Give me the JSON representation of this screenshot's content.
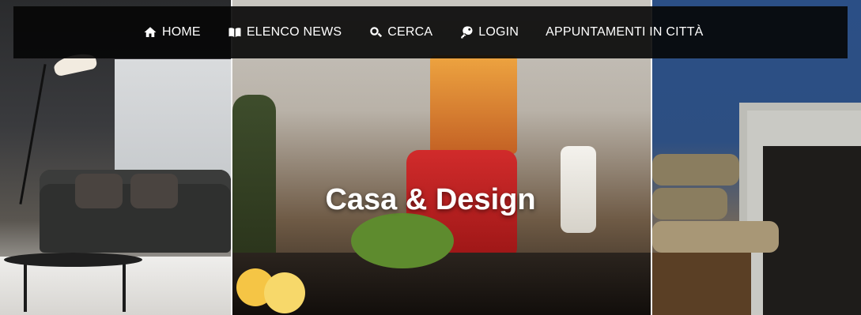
{
  "nav": {
    "items": [
      {
        "label": "HOME",
        "icon": "home-icon"
      },
      {
        "label": "ELENCO NEWS",
        "icon": "book-icon"
      },
      {
        "label": "CERCA",
        "icon": "search-icon"
      },
      {
        "label": "LOGIN",
        "icon": "key-icon"
      },
      {
        "label": "APPUNTAMENTI IN CITTÀ",
        "icon": ""
      }
    ]
  },
  "hero": {
    "title": "Casa & Design"
  }
}
